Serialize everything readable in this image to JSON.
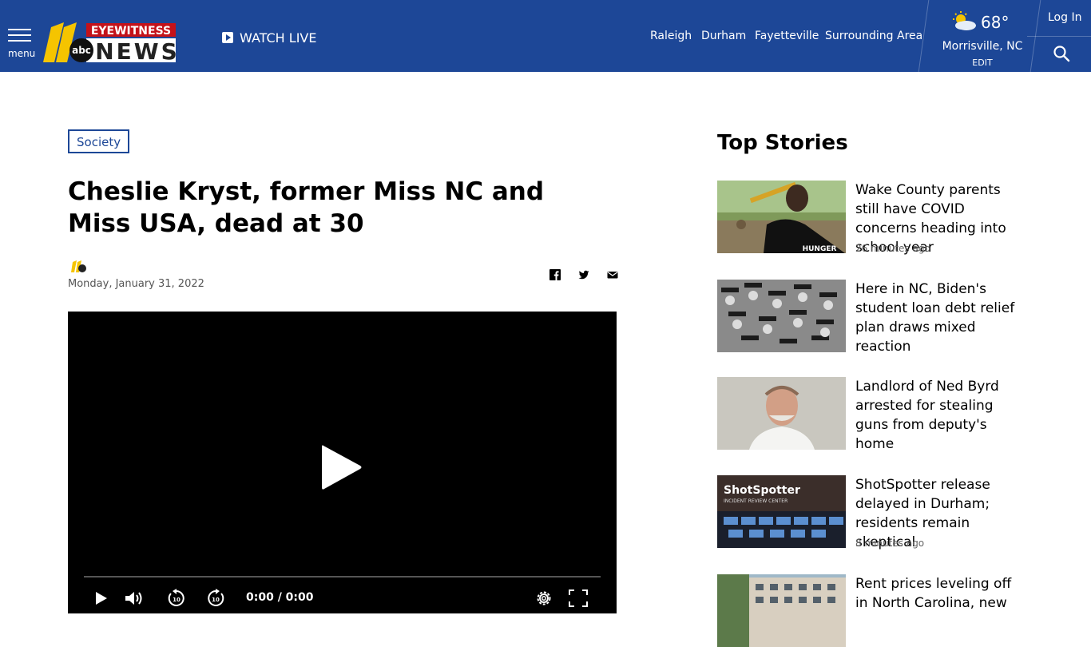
{
  "header": {
    "menu_label": "menu",
    "logo_top": "EYEWITNESS",
    "logo_bottom": "NEWS",
    "logo_number": "11",
    "logo_network": "abc",
    "watch_live": "WATCH LIVE",
    "nav": [
      "Raleigh",
      "Durham",
      "Fayetteville",
      "Surrounding Area"
    ],
    "weather": {
      "temp": "68°",
      "city": "Morrisville, NC",
      "edit": "EDIT"
    },
    "login": "Log In",
    "brand_color": "#1d4797"
  },
  "article": {
    "category": "Society",
    "title": "Cheslie Kryst, former Miss NC and Miss USA, dead at 30",
    "date": "Monday, January 31, 2022",
    "share_icons": [
      "facebook-icon",
      "twitter-icon",
      "email-icon"
    ]
  },
  "player": {
    "time": "0:00 / 0:00",
    "progress": 0
  },
  "sidebar": {
    "title": "Top Stories",
    "stories": [
      {
        "title": "Wake County parents still have COVID concerns heading into school year",
        "ago": "26 minutes ago"
      },
      {
        "title": "Here in NC, Biden's student loan debt relief plan draws mixed reaction",
        "ago": ""
      },
      {
        "title": "Landlord of Ned Byrd arrested for stealing guns from deputy's home",
        "ago": ""
      },
      {
        "title": "ShotSpotter release delayed in Durham; residents remain skeptical",
        "ago": "8 minutes ago"
      },
      {
        "title": "Rent prices leveling off in North Carolina, new",
        "ago": ""
      }
    ],
    "thumb_texts": {
      "shotspotter": "ShotSpotter",
      "shotspotter_sub": "INCIDENT REVIEW CENTER",
      "shirt": "HUNGER"
    }
  }
}
